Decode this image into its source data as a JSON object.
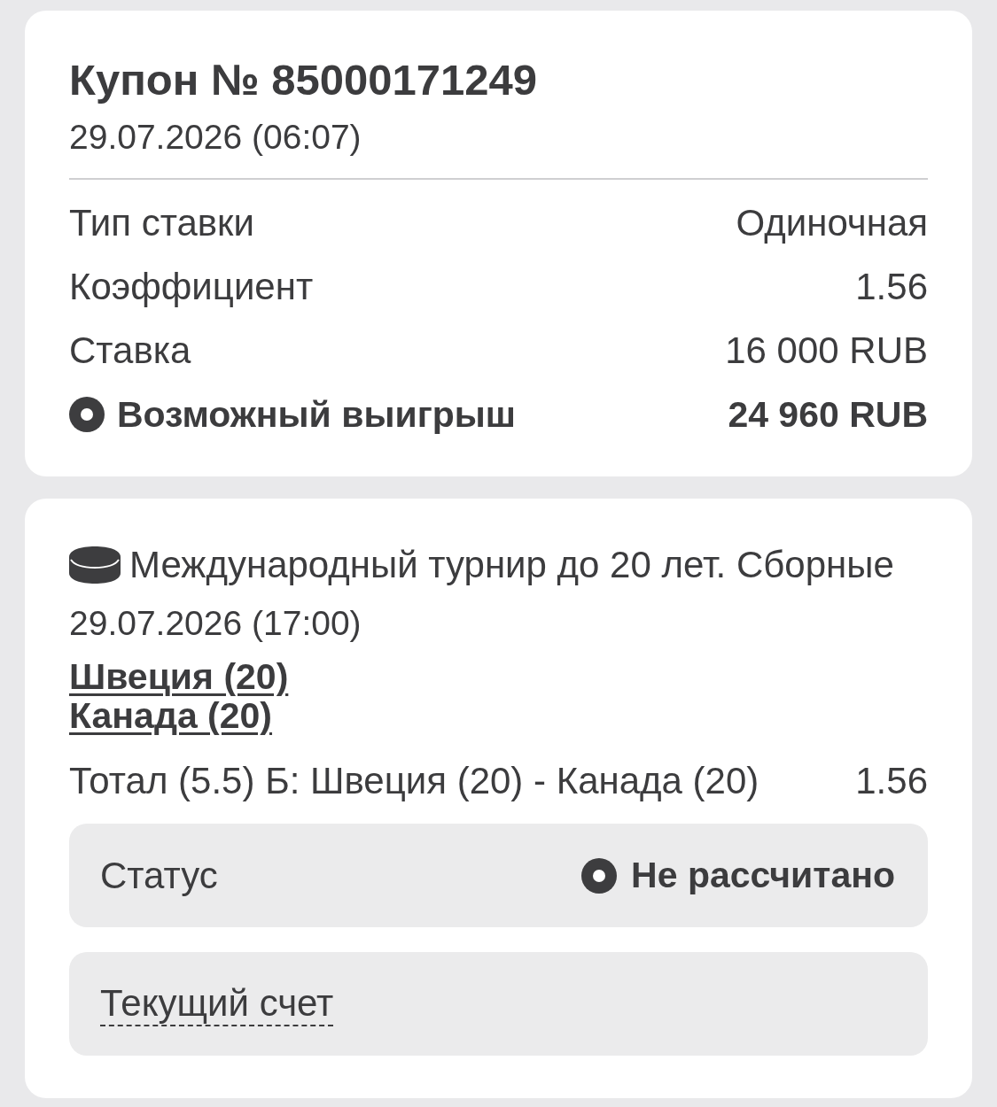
{
  "coupon": {
    "title": "Купон № 85000171249",
    "date": "29.07.2026 (06:07)",
    "rows": [
      {
        "kind": "plain",
        "label": "Тип ставки",
        "value": "Одиночная"
      },
      {
        "kind": "plain",
        "label": "Коэффициент",
        "value": "1.56"
      },
      {
        "kind": "plain",
        "label": "Ставка",
        "value": "16 000 RUB"
      },
      {
        "kind": "highlight",
        "label": "Возможный выигрыш",
        "value": "24 960 RUB"
      }
    ]
  },
  "event": {
    "tournament": "Международный турнир до 20 лет. Сборные",
    "date": "29.07.2026 (17:00)",
    "teams": [
      "Швеция (20)",
      "Канада (20)"
    ],
    "market": "Тотал (5.5) Б: Швеция (20) - Канада (20)",
    "odds": "1.56",
    "status": {
      "label": "Статус",
      "value": "Не рассчитано"
    },
    "score": {
      "label": "Текущий счет"
    }
  }
}
